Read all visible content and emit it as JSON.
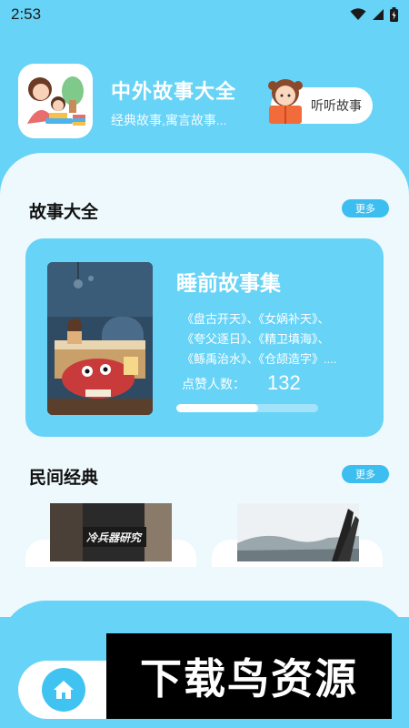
{
  "status_bar": {
    "time": "2:53"
  },
  "header": {
    "app_name": "中外故事大全",
    "subtitle": "经典故事,寓言故事...",
    "listen_button": "听听故事"
  },
  "section_stories": {
    "title": "故事大全",
    "more": "更多",
    "card": {
      "title": "睡前故事集",
      "description": "《盘古开天》、《女娲补天》、\n《夸父逐日》、《精卫填海》、\n《鲧禹治水》、《仓颉造字》....",
      "likes_label": "点赞人数：",
      "likes_count": "132",
      "progress": 0.58
    }
  },
  "section_folk": {
    "title": "民间经典",
    "more": "更多",
    "thumb_1_caption": "冷兵器研究"
  },
  "bottom_nav": {
    "home_icon": "home-icon"
  },
  "watermark": "下载鸟资源",
  "colors": {
    "primary": "#67d3f7",
    "accent": "#3cbff0",
    "sheet": "#eef9fd"
  }
}
